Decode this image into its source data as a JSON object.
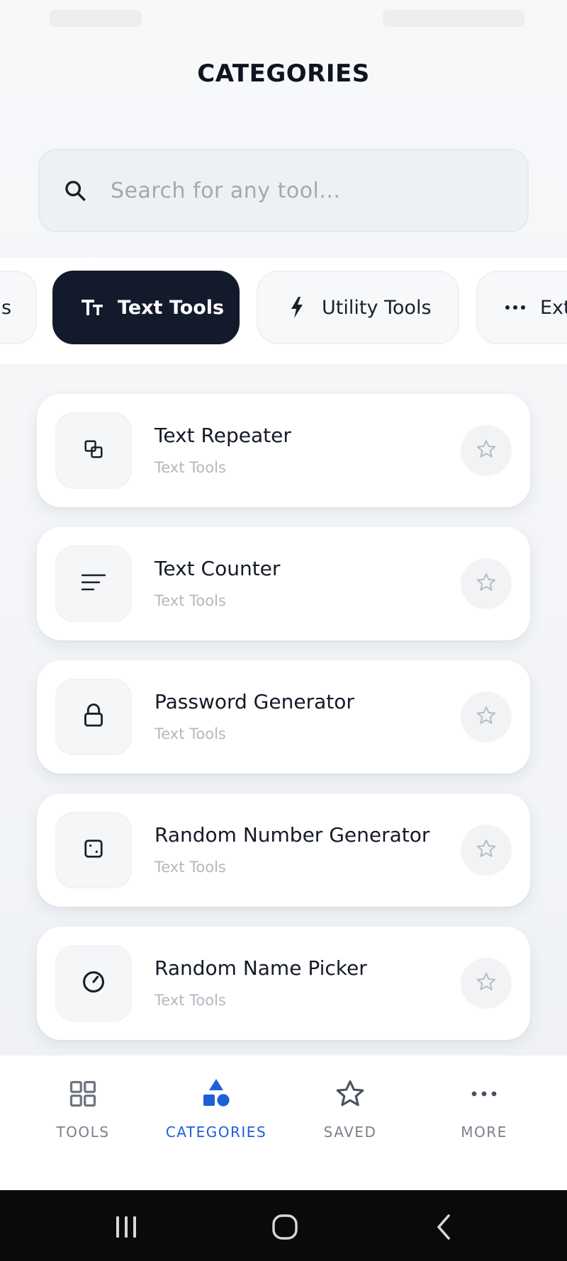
{
  "header": {
    "title": "CATEGORIES"
  },
  "search": {
    "placeholder": "Search for any tool..."
  },
  "chips": [
    {
      "label": "s",
      "icon": "none",
      "active": false
    },
    {
      "label": "Text Tools",
      "icon": "text-size-icon",
      "active": true
    },
    {
      "label": "Utility Tools",
      "icon": "lightning-icon",
      "active": false
    },
    {
      "label": "Ext",
      "icon": "more-dots-icon",
      "active": false
    }
  ],
  "tools": [
    {
      "name": "Text Repeater",
      "category": "Text Tools",
      "icon": "copy-icon"
    },
    {
      "name": "Text Counter",
      "category": "Text Tools",
      "icon": "lines-icon"
    },
    {
      "name": "Password Generator",
      "category": "Text Tools",
      "icon": "lock-icon"
    },
    {
      "name": "Random Number Generator",
      "category": "Text Tools",
      "icon": "dice-icon"
    },
    {
      "name": "Random Name Picker",
      "category": "Text Tools",
      "icon": "gauge-icon"
    }
  ],
  "nav": {
    "tools": "TOOLS",
    "categories": "CATEGORIES",
    "saved": "SAVED",
    "more": "MORE",
    "active": "categories"
  },
  "colors": {
    "accent": "#1f5fd6",
    "chip_active_bg": "#131a2b",
    "text_primary": "#141a26",
    "text_muted": "#b3b8bf"
  }
}
